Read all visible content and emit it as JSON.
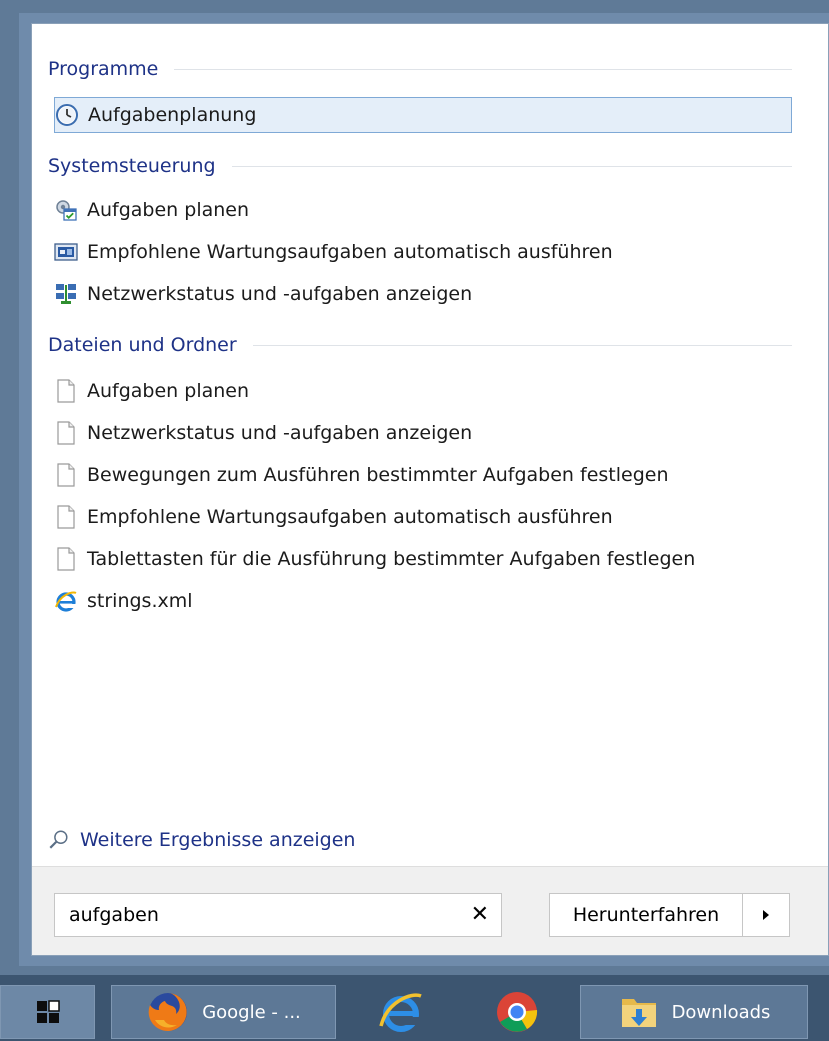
{
  "sections": [
    {
      "title": "Programme",
      "items": [
        {
          "label": "Aufgabenplanung",
          "icon": "clock-icon",
          "selected": true
        }
      ]
    },
    {
      "title": "Systemsteuerung",
      "items": [
        {
          "label": "Aufgaben planen",
          "icon": "task-scheduler-icon"
        },
        {
          "label": "Empfohlene Wartungsaufgaben automatisch ausführen",
          "icon": "maintenance-icon"
        },
        {
          "label": "Netzwerkstatus und -aufgaben anzeigen",
          "icon": "network-icon"
        }
      ]
    },
    {
      "title": "Dateien und Ordner",
      "items": [
        {
          "label": "Aufgaben planen",
          "icon": "document-icon"
        },
        {
          "label": "Netzwerkstatus und -aufgaben anzeigen",
          "icon": "document-icon"
        },
        {
          "label": "Bewegungen zum Ausführen bestimmter Aufgaben festlegen",
          "icon": "document-icon"
        },
        {
          "label": "Empfohlene Wartungsaufgaben automatisch ausführen",
          "icon": "document-icon"
        },
        {
          "label": "Tablettasten für die Ausführung bestimmter Aufgaben festlegen",
          "icon": "document-icon"
        },
        {
          "label": "strings.xml",
          "icon": "internet-explorer-icon"
        }
      ]
    }
  ],
  "more_results": {
    "label": "Weitere Ergebnisse anzeigen",
    "icon": "magnifier-icon"
  },
  "search": {
    "value": "aufgaben",
    "clear_icon": "close-icon"
  },
  "shutdown": {
    "label": "Herunterfahren",
    "arrow_icon": "triangle-right-icon"
  },
  "taskbar": {
    "start_icon": "windows-logo-icon",
    "items": [
      {
        "label": "Google - ...",
        "icon": "firefox-icon"
      },
      {
        "label": "",
        "icon": "internet-explorer-icon"
      },
      {
        "label": "",
        "icon": "chrome-icon"
      },
      {
        "label": "Downloads",
        "icon": "downloads-folder-icon"
      }
    ]
  },
  "colors": {
    "section_title": "#1e3287",
    "selected_bg": "#e4eef9",
    "selected_border": "#7fa9d6",
    "taskbar": "#3c5570"
  }
}
